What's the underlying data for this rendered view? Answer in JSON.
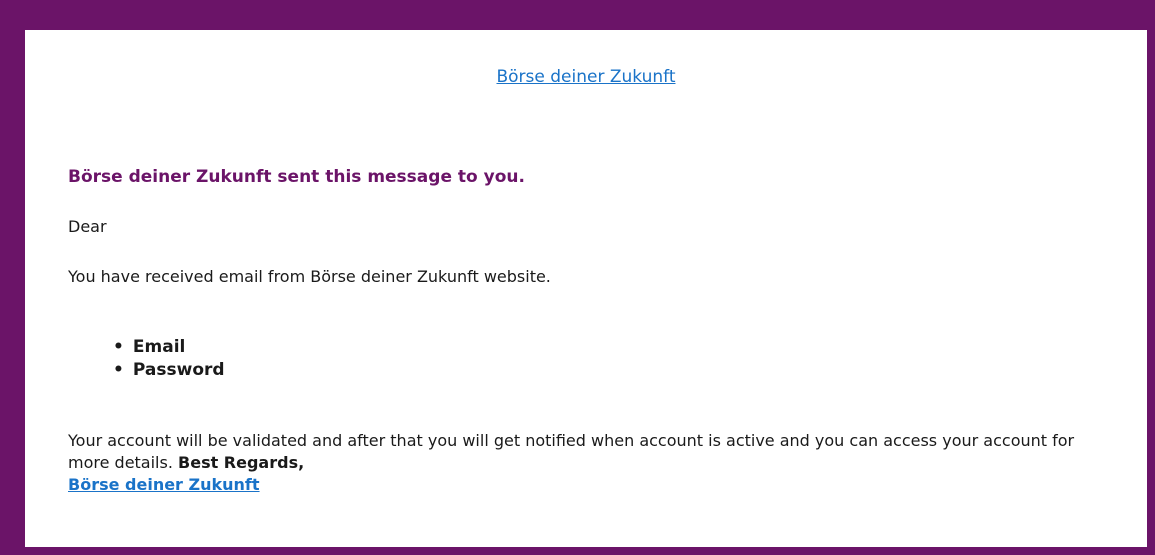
{
  "header": {
    "site_link": "Börse deiner Zukunft"
  },
  "message": {
    "sent_line": "Börse deiner Zukunft sent this message to you.",
    "greeting": "Dear",
    "intro": "You have received email from Börse deiner Zukunft website.",
    "fields": [
      "Email",
      "Password"
    ],
    "closing_text": "Your account will be validated and after that you will get notified when account is active and you can access your account for more details.",
    "regards": "Best Regards,",
    "signature_link": "Börse deiner Zukunft"
  },
  "colors": {
    "frame": "#6b1468",
    "card": "#ffffff",
    "link": "#1a73c8",
    "heading": "#6b1468",
    "text": "#1a1a1a"
  }
}
